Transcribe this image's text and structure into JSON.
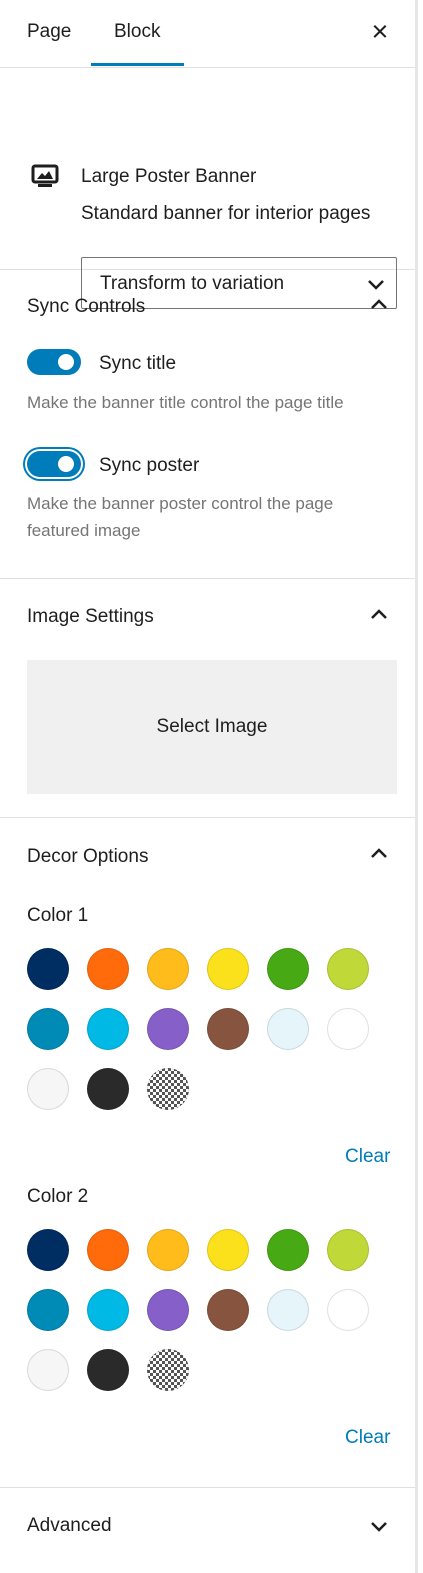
{
  "tabs": [
    {
      "label": "Page"
    },
    {
      "label": "Block"
    }
  ],
  "close_icon": "close-icon",
  "block": {
    "icon": "poster-banner-icon",
    "title": "Large Poster Banner",
    "description": "Standard banner for interior pages",
    "transform_select": "Transform to variation"
  },
  "sync_controls": {
    "title": "Sync Controls",
    "sync_title": {
      "label": "Sync title",
      "help": "Make the banner title control the page title",
      "enabled": true
    },
    "sync_poster": {
      "label": "Sync poster",
      "help": "Make the banner poster control the page featured image",
      "enabled": true
    }
  },
  "image_settings": {
    "title": "Image Settings",
    "select_image": "Select Image"
  },
  "decor_options": {
    "title": "Decor Options",
    "color1": {
      "label": "Color 1",
      "clear": "Clear"
    },
    "color2": {
      "label": "Color 2",
      "clear": "Clear"
    },
    "palette": [
      "#002d62",
      "#ff6b0b",
      "#ffbc1b",
      "#fbe11b",
      "#47a914",
      "#c0d938",
      "#008bb7",
      "#00b9e5",
      "#8660c8",
      "#87553f",
      "#e6f5fa",
      "#ffffff",
      "#f6f6f6",
      "#2a2a2a",
      "checkerboard"
    ]
  },
  "advanced": {
    "title": "Advanced"
  }
}
